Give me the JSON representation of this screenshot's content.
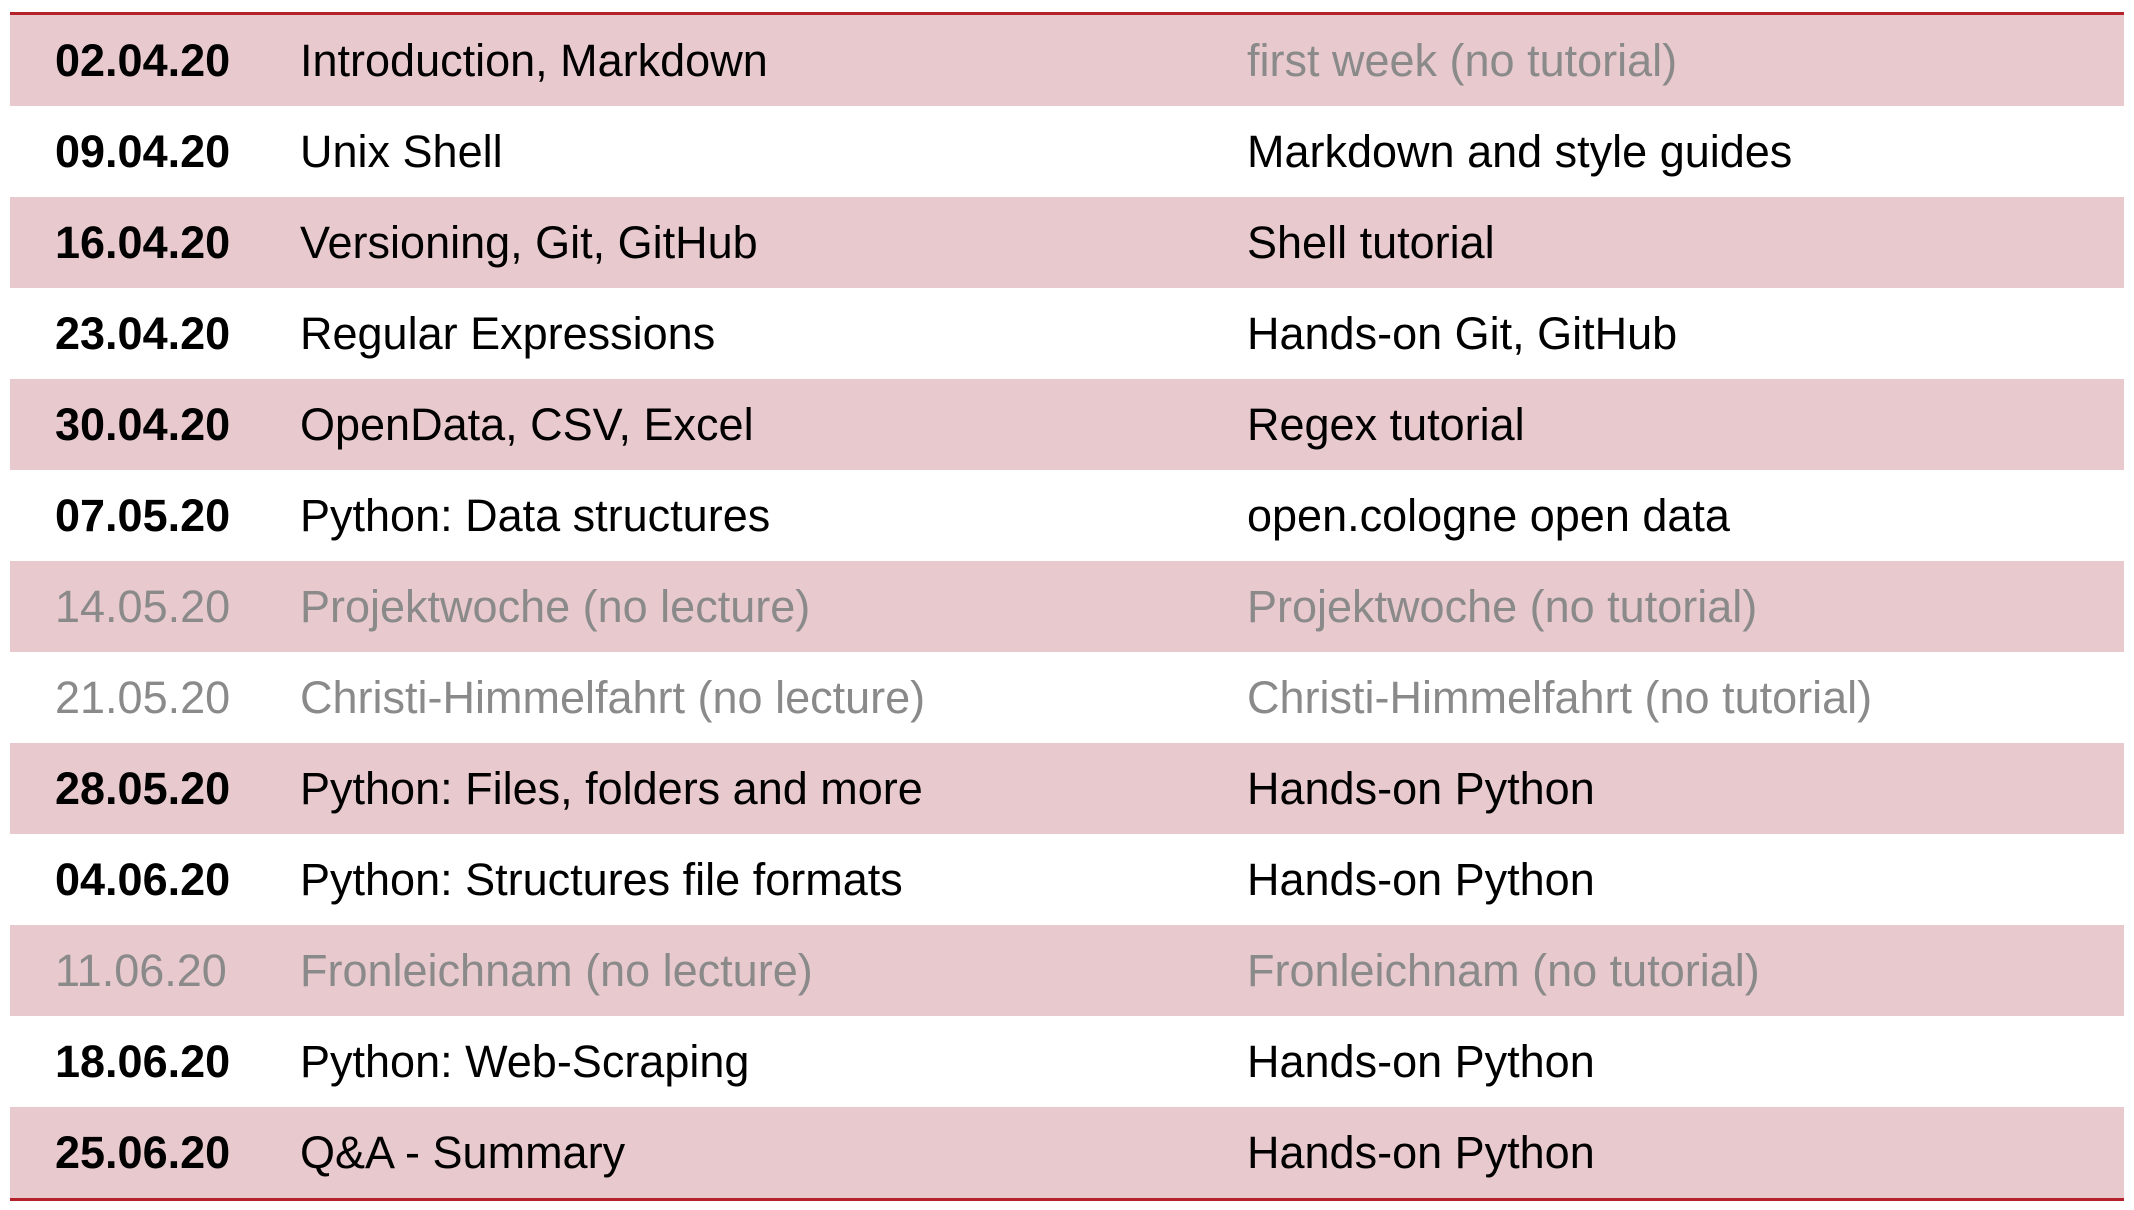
{
  "schedule": {
    "rows": [
      {
        "date": "02.04.20",
        "lecture": "Introduction, Markdown",
        "tutorial": "first week (no tutorial)",
        "muted": false,
        "tutorial_muted": true
      },
      {
        "date": "09.04.20",
        "lecture": "Unix Shell",
        "tutorial": "Markdown and style guides",
        "muted": false,
        "tutorial_muted": false
      },
      {
        "date": "16.04.20",
        "lecture": "Versioning, Git, GitHub",
        "tutorial": "Shell tutorial",
        "muted": false,
        "tutorial_muted": false
      },
      {
        "date": "23.04.20",
        "lecture": "Regular Expressions",
        "tutorial": "Hands-on Git, GitHub",
        "muted": false,
        "tutorial_muted": false
      },
      {
        "date": "30.04.20",
        "lecture": "OpenData, CSV, Excel",
        "tutorial": "Regex tutorial",
        "muted": false,
        "tutorial_muted": false
      },
      {
        "date": "07.05.20",
        "lecture": "Python: Data structures",
        "tutorial": "open.cologne open data",
        "muted": false,
        "tutorial_muted": false
      },
      {
        "date": "14.05.20",
        "lecture": "Projektwoche (no lecture)",
        "tutorial": "Projektwoche (no tutorial)",
        "muted": true,
        "tutorial_muted": true
      },
      {
        "date": "21.05.20",
        "lecture": "Christi-Himmelfahrt (no lecture)",
        "tutorial": "Christi-Himmelfahrt (no tutorial)",
        "muted": true,
        "tutorial_muted": true
      },
      {
        "date": "28.05.20",
        "lecture": "Python: Files, folders and more",
        "tutorial": "Hands-on Python",
        "muted": false,
        "tutorial_muted": false
      },
      {
        "date": "04.06.20",
        "lecture": "Python: Structures file formats",
        "tutorial": "Hands-on Python",
        "muted": false,
        "tutorial_muted": false
      },
      {
        "date": "11.06.20",
        "lecture": "Fronleichnam (no lecture)",
        "tutorial": "Fronleichnam (no tutorial)",
        "muted": true,
        "tutorial_muted": true
      },
      {
        "date": "18.06.20",
        "lecture": "Python: Web-Scraping",
        "tutorial": "Hands-on Python",
        "muted": false,
        "tutorial_muted": false
      },
      {
        "date": "25.06.20",
        "lecture": "Q&A - Summary",
        "tutorial": "Hands-on Python",
        "muted": false,
        "tutorial_muted": false
      }
    ]
  },
  "colors": {
    "stripe": "#e8c9cd",
    "border": "#b5222c",
    "muted_text": "#8a8a8a"
  }
}
